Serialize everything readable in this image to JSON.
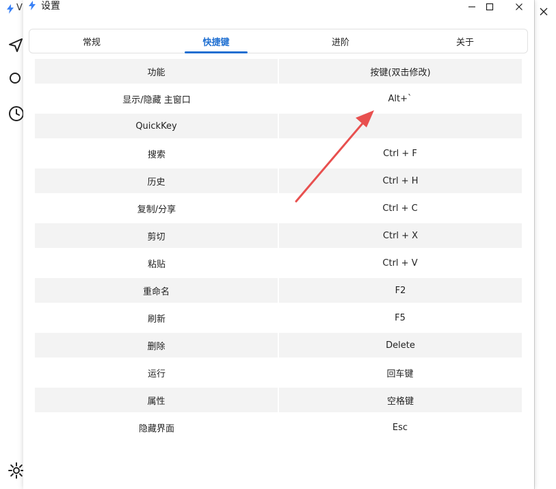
{
  "window": {
    "title": "设置"
  },
  "background_window": {
    "title_fragment": "V"
  },
  "tabs": [
    {
      "label": "常规",
      "active": false
    },
    {
      "label": "快捷键",
      "active": true
    },
    {
      "label": "进阶",
      "active": false
    },
    {
      "label": "关于",
      "active": false
    }
  ],
  "table": {
    "headers": {
      "function": "功能",
      "key": "按键(双击修改)"
    },
    "rows": [
      {
        "function": "显示/隐藏 主窗口",
        "key": "Alt+`"
      },
      {
        "function": "QuickKey",
        "key": ""
      },
      {
        "function": "搜索",
        "key": "Ctrl + F"
      },
      {
        "function": "历史",
        "key": "Ctrl + H"
      },
      {
        "function": "复制/分享",
        "key": "Ctrl + C"
      },
      {
        "function": "剪切",
        "key": "Ctrl + X"
      },
      {
        "function": "粘贴",
        "key": "Ctrl + V"
      },
      {
        "function": "重命名",
        "key": "F2"
      },
      {
        "function": "刷新",
        "key": "F5"
      },
      {
        "function": "删除",
        "key": "Delete"
      },
      {
        "function": "运行",
        "key": "回车键"
      },
      {
        "function": "属性",
        "key": "空格键"
      },
      {
        "function": "隐藏界面",
        "key": "Esc"
      }
    ]
  },
  "colors": {
    "accent": "#1f6fd1",
    "arrow": "#e8504f",
    "row_shade": "#f3f3f3"
  }
}
